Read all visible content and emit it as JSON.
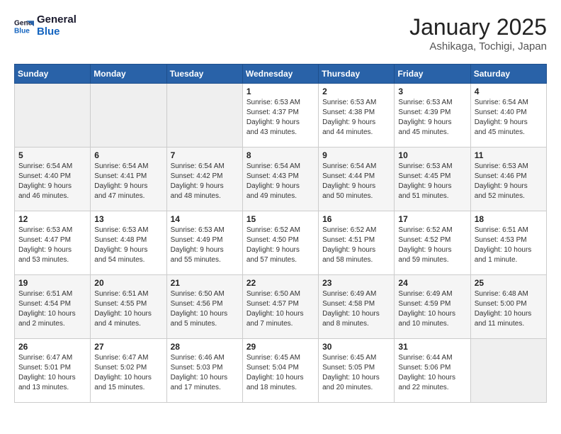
{
  "header": {
    "logo_line1": "General",
    "logo_line2": "Blue",
    "month": "January 2025",
    "location": "Ashikaga, Tochigi, Japan"
  },
  "weekdays": [
    "Sunday",
    "Monday",
    "Tuesday",
    "Wednesday",
    "Thursday",
    "Friday",
    "Saturday"
  ],
  "weeks": [
    [
      {
        "day": "",
        "info": ""
      },
      {
        "day": "",
        "info": ""
      },
      {
        "day": "",
        "info": ""
      },
      {
        "day": "1",
        "info": "Sunrise: 6:53 AM\nSunset: 4:37 PM\nDaylight: 9 hours\nand 43 minutes."
      },
      {
        "day": "2",
        "info": "Sunrise: 6:53 AM\nSunset: 4:38 PM\nDaylight: 9 hours\nand 44 minutes."
      },
      {
        "day": "3",
        "info": "Sunrise: 6:53 AM\nSunset: 4:39 PM\nDaylight: 9 hours\nand 45 minutes."
      },
      {
        "day": "4",
        "info": "Sunrise: 6:54 AM\nSunset: 4:40 PM\nDaylight: 9 hours\nand 45 minutes."
      }
    ],
    [
      {
        "day": "5",
        "info": "Sunrise: 6:54 AM\nSunset: 4:40 PM\nDaylight: 9 hours\nand 46 minutes."
      },
      {
        "day": "6",
        "info": "Sunrise: 6:54 AM\nSunset: 4:41 PM\nDaylight: 9 hours\nand 47 minutes."
      },
      {
        "day": "7",
        "info": "Sunrise: 6:54 AM\nSunset: 4:42 PM\nDaylight: 9 hours\nand 48 minutes."
      },
      {
        "day": "8",
        "info": "Sunrise: 6:54 AM\nSunset: 4:43 PM\nDaylight: 9 hours\nand 49 minutes."
      },
      {
        "day": "9",
        "info": "Sunrise: 6:54 AM\nSunset: 4:44 PM\nDaylight: 9 hours\nand 50 minutes."
      },
      {
        "day": "10",
        "info": "Sunrise: 6:53 AM\nSunset: 4:45 PM\nDaylight: 9 hours\nand 51 minutes."
      },
      {
        "day": "11",
        "info": "Sunrise: 6:53 AM\nSunset: 4:46 PM\nDaylight: 9 hours\nand 52 minutes."
      }
    ],
    [
      {
        "day": "12",
        "info": "Sunrise: 6:53 AM\nSunset: 4:47 PM\nDaylight: 9 hours\nand 53 minutes."
      },
      {
        "day": "13",
        "info": "Sunrise: 6:53 AM\nSunset: 4:48 PM\nDaylight: 9 hours\nand 54 minutes."
      },
      {
        "day": "14",
        "info": "Sunrise: 6:53 AM\nSunset: 4:49 PM\nDaylight: 9 hours\nand 55 minutes."
      },
      {
        "day": "15",
        "info": "Sunrise: 6:52 AM\nSunset: 4:50 PM\nDaylight: 9 hours\nand 57 minutes."
      },
      {
        "day": "16",
        "info": "Sunrise: 6:52 AM\nSunset: 4:51 PM\nDaylight: 9 hours\nand 58 minutes."
      },
      {
        "day": "17",
        "info": "Sunrise: 6:52 AM\nSunset: 4:52 PM\nDaylight: 9 hours\nand 59 minutes."
      },
      {
        "day": "18",
        "info": "Sunrise: 6:51 AM\nSunset: 4:53 PM\nDaylight: 10 hours\nand 1 minute."
      }
    ],
    [
      {
        "day": "19",
        "info": "Sunrise: 6:51 AM\nSunset: 4:54 PM\nDaylight: 10 hours\nand 2 minutes."
      },
      {
        "day": "20",
        "info": "Sunrise: 6:51 AM\nSunset: 4:55 PM\nDaylight: 10 hours\nand 4 minutes."
      },
      {
        "day": "21",
        "info": "Sunrise: 6:50 AM\nSunset: 4:56 PM\nDaylight: 10 hours\nand 5 minutes."
      },
      {
        "day": "22",
        "info": "Sunrise: 6:50 AM\nSunset: 4:57 PM\nDaylight: 10 hours\nand 7 minutes."
      },
      {
        "day": "23",
        "info": "Sunrise: 6:49 AM\nSunset: 4:58 PM\nDaylight: 10 hours\nand 8 minutes."
      },
      {
        "day": "24",
        "info": "Sunrise: 6:49 AM\nSunset: 4:59 PM\nDaylight: 10 hours\nand 10 minutes."
      },
      {
        "day": "25",
        "info": "Sunrise: 6:48 AM\nSunset: 5:00 PM\nDaylight: 10 hours\nand 11 minutes."
      }
    ],
    [
      {
        "day": "26",
        "info": "Sunrise: 6:47 AM\nSunset: 5:01 PM\nDaylight: 10 hours\nand 13 minutes."
      },
      {
        "day": "27",
        "info": "Sunrise: 6:47 AM\nSunset: 5:02 PM\nDaylight: 10 hours\nand 15 minutes."
      },
      {
        "day": "28",
        "info": "Sunrise: 6:46 AM\nSunset: 5:03 PM\nDaylight: 10 hours\nand 17 minutes."
      },
      {
        "day": "29",
        "info": "Sunrise: 6:45 AM\nSunset: 5:04 PM\nDaylight: 10 hours\nand 18 minutes."
      },
      {
        "day": "30",
        "info": "Sunrise: 6:45 AM\nSunset: 5:05 PM\nDaylight: 10 hours\nand 20 minutes."
      },
      {
        "day": "31",
        "info": "Sunrise: 6:44 AM\nSunset: 5:06 PM\nDaylight: 10 hours\nand 22 minutes."
      },
      {
        "day": "",
        "info": ""
      }
    ]
  ]
}
